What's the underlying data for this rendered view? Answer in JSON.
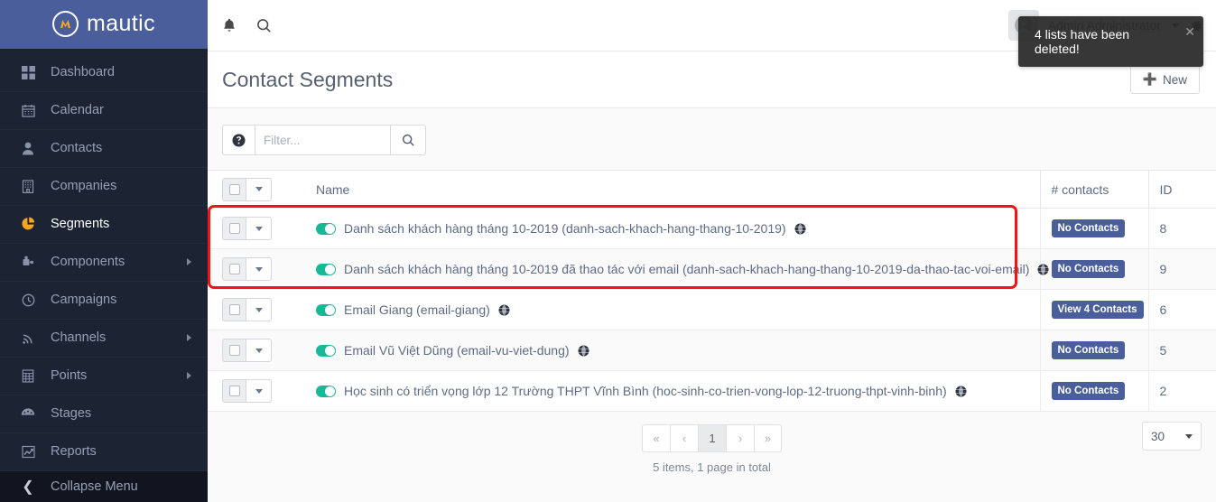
{
  "brand": {
    "name": "mautic",
    "logo_icon": "mautic-logo-icon",
    "accent": "#f5a623",
    "bar_color": "#4a5e9b"
  },
  "sidebar": {
    "items": [
      {
        "label": "Dashboard",
        "icon": "grid-icon",
        "active": false,
        "expandable": false
      },
      {
        "label": "Calendar",
        "icon": "calendar-icon",
        "active": false,
        "expandable": false
      },
      {
        "label": "Contacts",
        "icon": "user-icon",
        "active": false,
        "expandable": false
      },
      {
        "label": "Companies",
        "icon": "building-icon",
        "active": false,
        "expandable": false
      },
      {
        "label": "Segments",
        "icon": "pie-chart-icon",
        "active": true,
        "expandable": false
      },
      {
        "label": "Components",
        "icon": "puzzle-icon",
        "active": false,
        "expandable": true
      },
      {
        "label": "Campaigns",
        "icon": "clock-icon",
        "active": false,
        "expandable": false
      },
      {
        "label": "Channels",
        "icon": "rss-icon",
        "active": false,
        "expandable": true
      },
      {
        "label": "Points",
        "icon": "calculator-icon",
        "active": false,
        "expandable": true
      },
      {
        "label": "Stages",
        "icon": "gauge-icon",
        "active": false,
        "expandable": false
      },
      {
        "label": "Reports",
        "icon": "line-chart-icon",
        "active": false,
        "expandable": false
      }
    ],
    "collapse": {
      "label": "Collapse Menu",
      "icon": "chevron-left-icon"
    }
  },
  "topbar": {
    "notifications_icon": "bell-icon",
    "search_icon": "search-icon",
    "user_name": "Admin Administrator",
    "avatar_icon": "avatar-icon",
    "settings_icon": "gear-icon"
  },
  "toast": {
    "message": "4 lists have been deleted!",
    "close_icon": "close-icon"
  },
  "header": {
    "title": "Contact Segments",
    "new_button": "New",
    "new_icon": "plus-icon"
  },
  "toolbar": {
    "help_icon": "question-circle-icon",
    "search_icon": "search-icon",
    "filter_placeholder": "Filter...",
    "filter_value": ""
  },
  "table": {
    "columns": {
      "select": "",
      "name": "Name",
      "contacts": "# contacts",
      "id": "ID"
    },
    "header_checkbox_icon": "checkbox-icon",
    "header_caret_icon": "chevron-down-icon",
    "rows": [
      {
        "name": "Danh sách khách hàng tháng 10-2019 (danh-sach-khach-hang-thang-10-2019)",
        "published": true,
        "globe_icon": "globe-icon",
        "contacts_badge": "No Contacts",
        "id": "8",
        "highlighted": true
      },
      {
        "name": "Danh sách khách hàng tháng 10-2019 đã thao tác với email (danh-sach-khach-hang-thang-10-2019-da-thao-tac-voi-email)",
        "published": true,
        "globe_icon": "globe-icon",
        "contacts_badge": "No Contacts",
        "id": "9",
        "highlighted": true
      },
      {
        "name": "Email Giang (email-giang)",
        "published": true,
        "globe_icon": "globe-icon",
        "contacts_badge": "View 4 Contacts",
        "id": "6",
        "highlighted": false
      },
      {
        "name": "Email Vũ Việt Dũng (email-vu-viet-dung)",
        "published": true,
        "globe_icon": "globe-icon",
        "contacts_badge": "No Contacts",
        "id": "5",
        "highlighted": false
      },
      {
        "name": "Học sinh có triển vọng lớp 12 Trường THPT Vĩnh Bình (hoc-sinh-co-trien-vong-lop-12-truong-thpt-vinh-binh)",
        "published": true,
        "globe_icon": "globe-icon",
        "contacts_badge": "No Contacts",
        "id": "2",
        "highlighted": false
      }
    ]
  },
  "pagination": {
    "first": "«",
    "prev": "‹",
    "current": "1",
    "next": "›",
    "last": "»",
    "summary": "5 items, 1 page in total",
    "page_size": "30"
  },
  "annotation": {
    "color": "#f01414",
    "shape": "rectangle"
  }
}
